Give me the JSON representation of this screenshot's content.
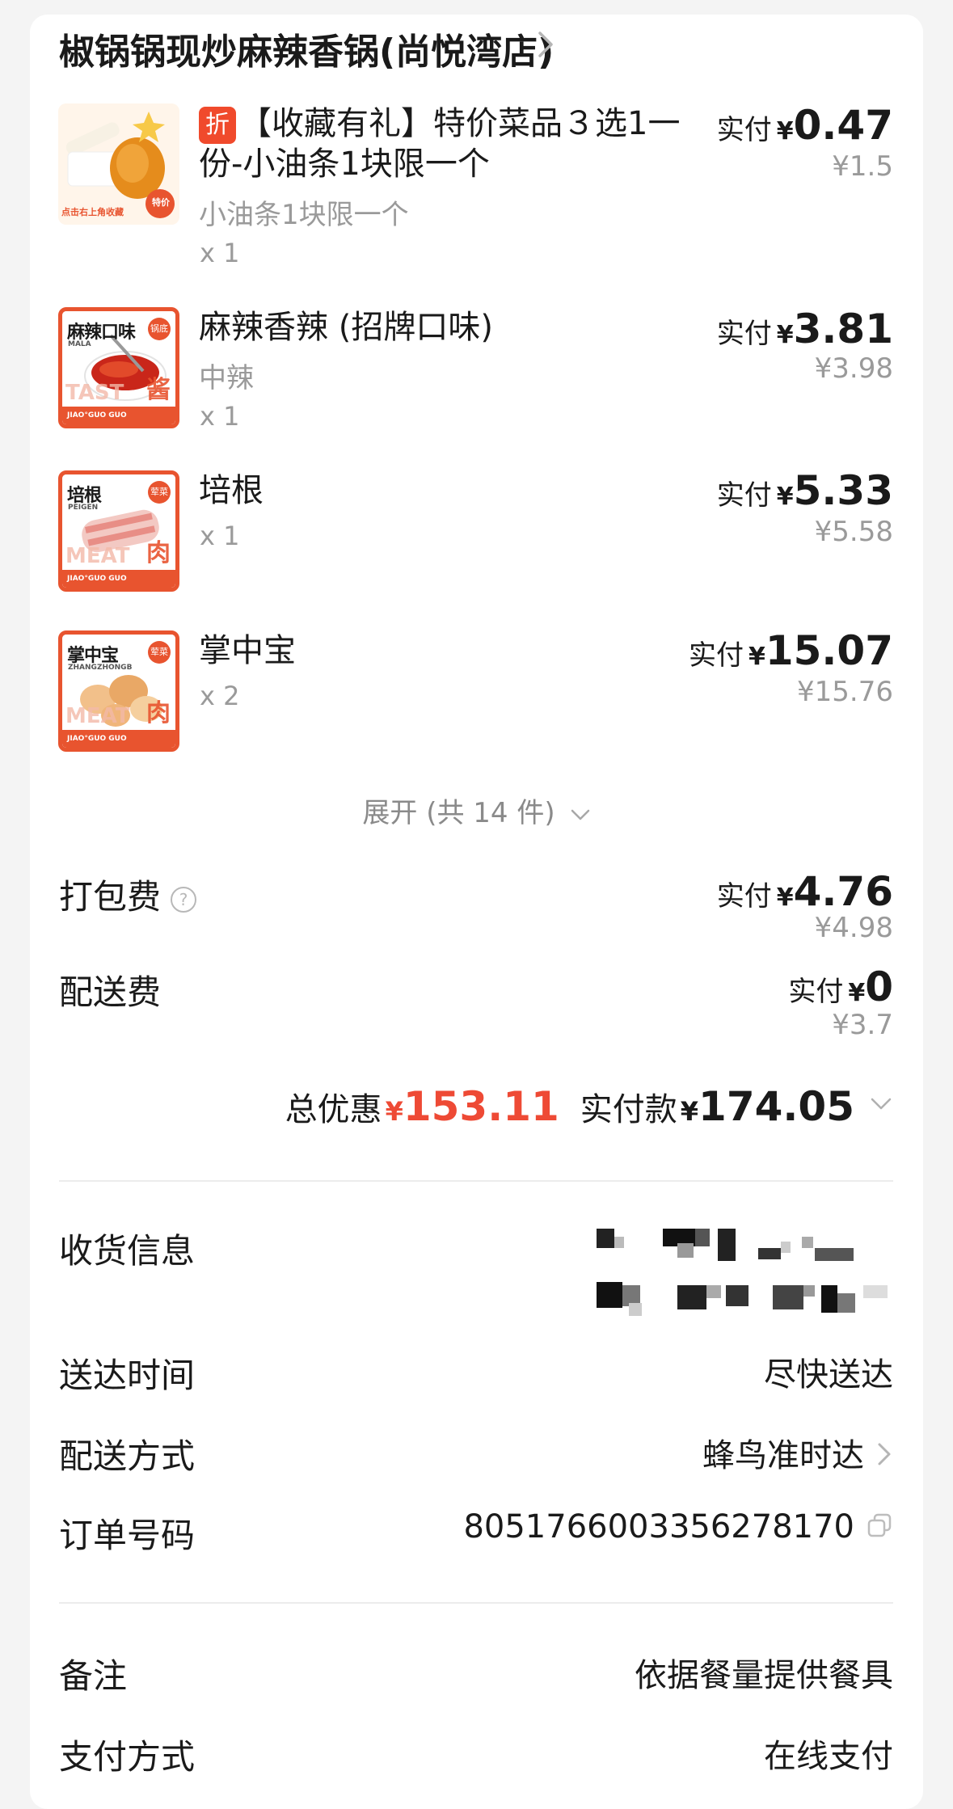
{
  "store": {
    "name": "椒锅锅现炒麻辣香锅(尚悦湾店)"
  },
  "items": [
    {
      "promo_tag": "折",
      "name": "【收藏有礼】特价菜品３选1一份-小油条1块限一个",
      "spec": "小油条1块限一个",
      "qty": "x 1",
      "paid_label": "实付",
      "yen": "¥",
      "paid": "0.47",
      "original": "¥1.5",
      "thumb_text": "点击右上角收藏",
      "thumb_badge": "特价"
    },
    {
      "name": "麻辣香辣 (招牌口味)",
      "spec": "中辣",
      "qty": "x 1",
      "paid_label": "实付",
      "yen": "¥",
      "paid": "3.81",
      "original": "¥3.98",
      "thumb_title": "麻辣口味",
      "thumb_sub": "MALA",
      "thumb_badge": "锅底",
      "thumb_big": "酱",
      "thumb_ghost": "TAST",
      "thumb_foot": "JIAO°GUO GUO"
    },
    {
      "name": "培根",
      "qty": "x 1",
      "paid_label": "实付",
      "yen": "¥",
      "paid": "5.33",
      "original": "¥5.58",
      "thumb_title": "培根",
      "thumb_sub": "PEIGEN",
      "thumb_badge": "荤菜",
      "thumb_big": "肉",
      "thumb_ghost": "MEAT",
      "thumb_foot": "JIAO°GUO GUO"
    },
    {
      "name": "掌中宝",
      "qty": "x 2",
      "paid_label": "实付",
      "yen": "¥",
      "paid": "15.07",
      "original": "¥15.76",
      "thumb_title": "掌中宝",
      "thumb_sub": "ZHANGZHONGB",
      "thumb_badge": "荤菜",
      "thumb_big": "肉",
      "thumb_ghost": "MEAT",
      "thumb_foot": "JIAO°GUO GUO"
    }
  ],
  "expand": {
    "label": "展开 (共 14 件)"
  },
  "fees": {
    "packing": {
      "label": "打包费",
      "help_icon": "?",
      "paid_label": "实付",
      "yen": "¥",
      "paid": "4.76",
      "original": "¥4.98"
    },
    "delivery": {
      "label": "配送费",
      "paid_label": "实付",
      "yen": "¥",
      "paid": "0",
      "original": "¥3.7"
    }
  },
  "summary": {
    "discount_label": "总优惠",
    "yen": "¥",
    "discount": "153.11",
    "paid_label": "实付款",
    "paid": "174.05"
  },
  "info": {
    "receiver_label": "收货信息",
    "delivery_time_label": "送达时间",
    "delivery_time_value": "尽快送达",
    "delivery_method_label": "配送方式",
    "delivery_method_value": "蜂鸟准时达",
    "order_no_label": "订单号码",
    "order_no_value": "8051766003356278170",
    "remark_label": "备注",
    "remark_value": "依据餐量提供餐具",
    "payment_label": "支付方式",
    "payment_value": "在线支付"
  },
  "colors": {
    "accent_red": "#ee4a35",
    "brand_orange": "#e8542f",
    "muted": "#9a9a9a"
  }
}
